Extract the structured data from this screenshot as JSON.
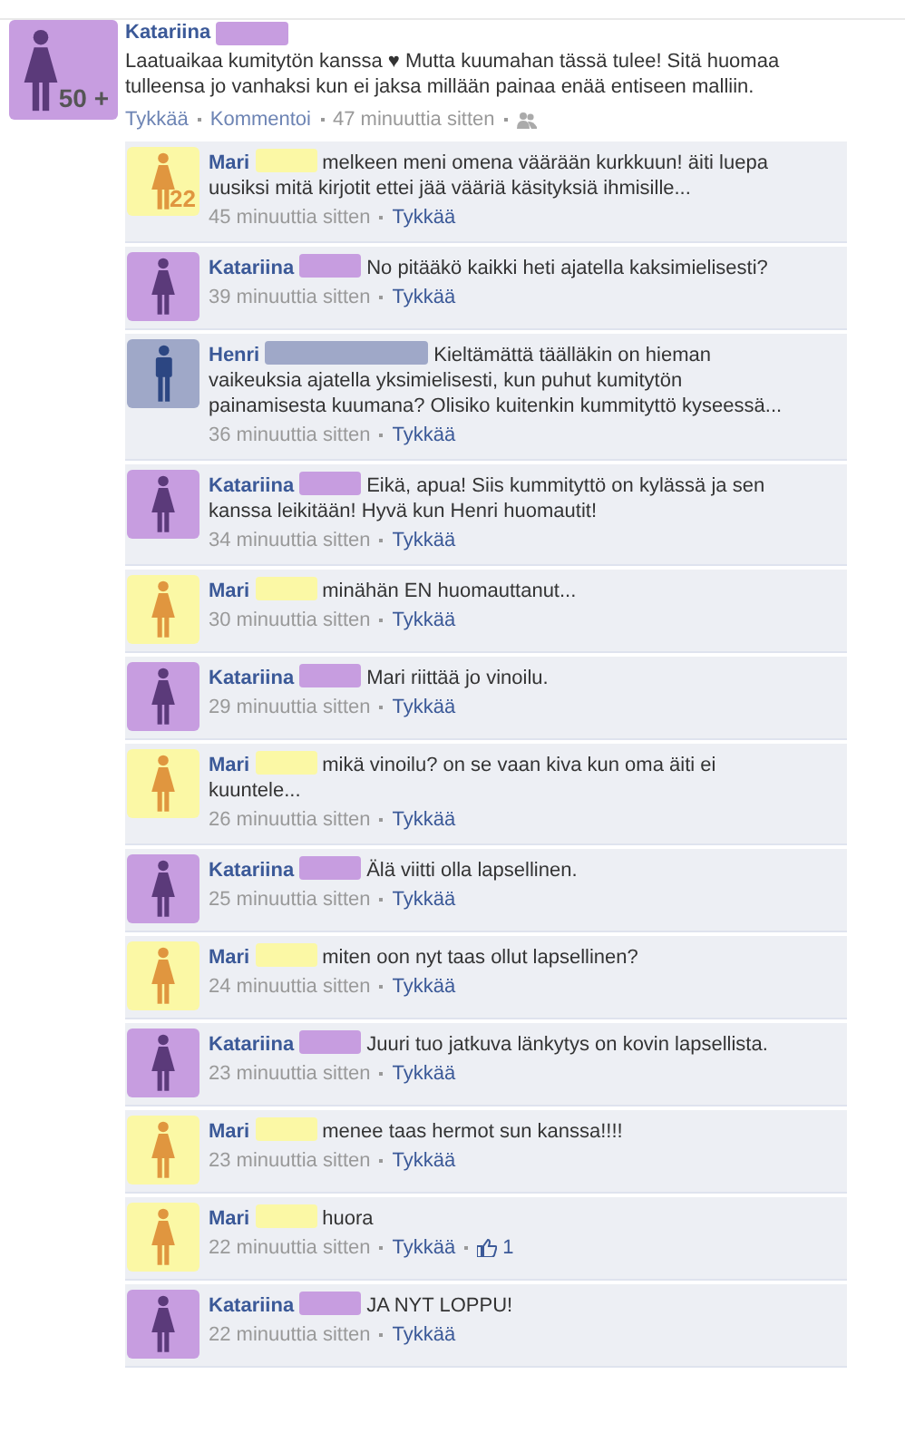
{
  "post": {
    "author": "Katariina",
    "avatar": {
      "kind": "female",
      "color": "#c79de0",
      "figure": {
        "color": "#5b3a7a"
      },
      "badge": "50 +"
    },
    "text": "Laatuaikaa kumitytön kanssa ♥ Mutta kuumahan tässä tulee! Sitä huomaa tulleensa jo vanhaksi kun ei jaksa millään painaa enää entiseen malliin.",
    "actions": {
      "like": "Tykkää",
      "comment": "Kommentoi",
      "time": "47 minuuttia sitten"
    }
  },
  "comments": [
    {
      "author": "Mari",
      "avatar": {
        "kind": "female",
        "color": "#fbf8a5",
        "figure": {
          "color": "#e0963f"
        },
        "badge": "22"
      },
      "text": "melkeen meni omena väärään kurkkuun! äiti luepa uusiksi mitä kirjotit ettei jää vääriä käsityksiä ihmisille...",
      "time": "45 minuuttia sitten",
      "like": "Tykkää"
    },
    {
      "author": "Katariina",
      "avatar": {
        "kind": "female",
        "color": "#c79de0",
        "figure": {
          "color": "#5b3a7a"
        }
      },
      "text": "No pitääkö kaikki heti ajatella kaksimielisesti?",
      "time": "39 minuuttia sitten",
      "like": "Tykkää"
    },
    {
      "author": "Henri",
      "avatar": {
        "kind": "male",
        "color": "#9fa8c8",
        "figure": {
          "color": "#2c4682"
        }
      },
      "text": "Kieltämättä täälläkin on hieman vaikeuksia ajatella yksimielisesti, kun puhut kumitytön painamisesta kuumana? Olisiko kuitenkin kummityttö kyseessä...",
      "time": "36 minuuttia sitten",
      "like": "Tykkää"
    },
    {
      "author": "Katariina",
      "avatar": {
        "kind": "female",
        "color": "#c79de0",
        "figure": {
          "color": "#5b3a7a"
        }
      },
      "text": "Eikä, apua! Siis kummityttö on kylässä ja sen kanssa leikitään! Hyvä kun Henri huomautit!",
      "time": "34 minuuttia sitten",
      "like": "Tykkää"
    },
    {
      "author": "Mari",
      "avatar": {
        "kind": "female",
        "color": "#fbf8a5",
        "figure": {
          "color": "#e0963f"
        }
      },
      "text": "minähän EN huomauttanut...",
      "time": "30 minuuttia sitten",
      "like": "Tykkää"
    },
    {
      "author": "Katariina",
      "avatar": {
        "kind": "female",
        "color": "#c79de0",
        "figure": {
          "color": "#5b3a7a"
        }
      },
      "text": "Mari riittää jo vinoilu.",
      "time": "29 minuuttia sitten",
      "like": "Tykkää"
    },
    {
      "author": "Mari",
      "avatar": {
        "kind": "female",
        "color": "#fbf8a5",
        "figure": {
          "color": "#e0963f"
        }
      },
      "text": "mikä vinoilu? on se vaan kiva kun oma äiti ei kuuntele...",
      "time": "26 minuuttia sitten",
      "like": "Tykkää"
    },
    {
      "author": "Katariina",
      "avatar": {
        "kind": "female",
        "color": "#c79de0",
        "figure": {
          "color": "#5b3a7a"
        }
      },
      "text": "Älä viitti olla lapsellinen.",
      "time": "25 minuuttia sitten",
      "like": "Tykkää"
    },
    {
      "author": "Mari",
      "avatar": {
        "kind": "female",
        "color": "#fbf8a5",
        "figure": {
          "color": "#e0963f"
        }
      },
      "text": "miten oon nyt taas ollut lapsellinen?",
      "time": "24 minuuttia sitten",
      "like": "Tykkää"
    },
    {
      "author": "Katariina",
      "avatar": {
        "kind": "female",
        "color": "#c79de0",
        "figure": {
          "color": "#5b3a7a"
        }
      },
      "text": "Juuri tuo jatkuva länkytys on kovin lapsellista.",
      "time": "23 minuuttia sitten",
      "like": "Tykkää"
    },
    {
      "author": "Mari",
      "avatar": {
        "kind": "female",
        "color": "#fbf8a5",
        "figure": {
          "color": "#e0963f"
        }
      },
      "text": "menee taas hermot sun kanssa!!!!",
      "time": "23 minuuttia sitten",
      "like": "Tykkää"
    },
    {
      "author": "Mari",
      "avatar": {
        "kind": "female",
        "color": "#fbf8a5",
        "figure": {
          "color": "#e0963f"
        }
      },
      "text": "huora",
      "time": "22 minuuttia sitten",
      "like": "Tykkää",
      "likes": "1"
    },
    {
      "author": "Katariina",
      "avatar": {
        "kind": "female",
        "color": "#c79de0",
        "figure": {
          "color": "#5b3a7a"
        }
      },
      "text": "JA NYT LOPPU!",
      "time": "22 minuuttia sitten",
      "like": "Tykkää"
    }
  ]
}
